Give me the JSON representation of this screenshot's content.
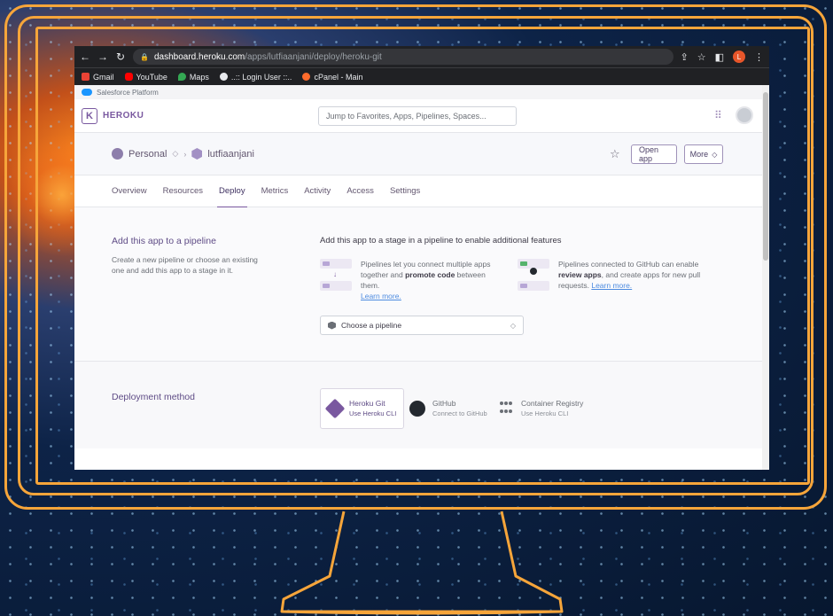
{
  "browser": {
    "url_host": "dashboard.heroku.com",
    "url_path": "/apps/lutfiaanjani/deploy/heroku-git",
    "profile_initial": "L",
    "bookmarks": [
      "Gmail",
      "YouTube",
      "Maps",
      "..:: Login User ::..",
      "cPanel - Main"
    ]
  },
  "salesforce_bar": {
    "label": "Salesforce Platform"
  },
  "header": {
    "brand": "HEROKU",
    "search_placeholder": "Jump to Favorites, Apps, Pipelines, Spaces..."
  },
  "app_bar": {
    "account": "Personal",
    "app_name": "lutfiaanjani",
    "open_app": "Open app",
    "more": "More"
  },
  "tabs": [
    "Overview",
    "Resources",
    "Deploy",
    "Metrics",
    "Activity",
    "Access",
    "Settings"
  ],
  "pipeline_section": {
    "title": "Add this app to a pipeline",
    "description": "Create a new pipeline or choose an existing one and add this app to a stage in it.",
    "heading": "Add this app to a stage in a pipeline to enable additional features",
    "feature1_pre": "Pipelines let you connect multiple apps together and ",
    "feature1_bold": "promote code",
    "feature1_post": " between them.",
    "feature2_pre": "Pipelines connected to GitHub can enable ",
    "feature2_bold": "review apps",
    "feature2_post": ", and create apps for new pull requests.",
    "learn_more": "Learn more.",
    "select_label": "Choose a pipeline"
  },
  "deploy_section": {
    "title": "Deployment method",
    "methods": [
      {
        "name": "Heroku Git",
        "sub": "Use Heroku CLI"
      },
      {
        "name": "GitHub",
        "sub": "Connect to GitHub"
      },
      {
        "name": "Container Registry",
        "sub": "Use Heroku CLI"
      }
    ]
  },
  "colors": {
    "frame": "#f6a53a",
    "heroku_purple": "#79589f",
    "chrome_dark": "#202124"
  }
}
